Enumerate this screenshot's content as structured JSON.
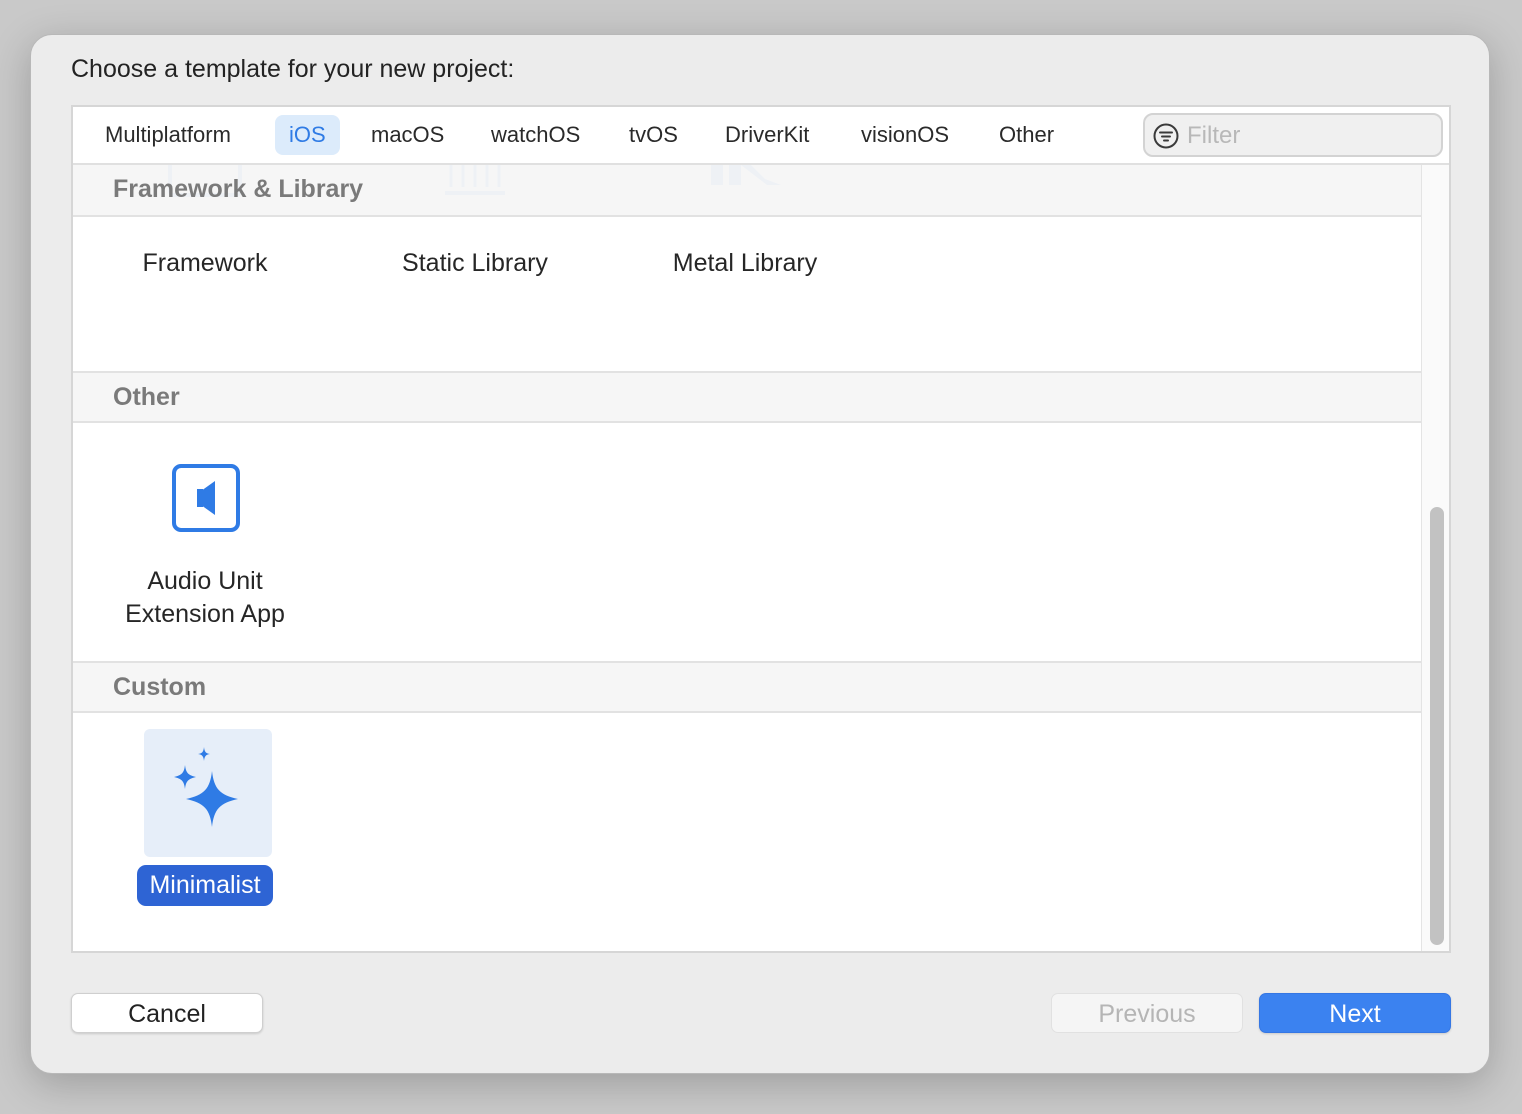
{
  "dialog": {
    "prompt": "Choose a template for your new project:"
  },
  "tabs": [
    {
      "label": "Multiplatform",
      "active": false
    },
    {
      "label": "iOS",
      "active": true
    },
    {
      "label": "macOS",
      "active": false
    },
    {
      "label": "watchOS",
      "active": false
    },
    {
      "label": "tvOS",
      "active": false
    },
    {
      "label": "DriverKit",
      "active": false
    },
    {
      "label": "visionOS",
      "active": false
    },
    {
      "label": "Other",
      "active": false
    }
  ],
  "filter": {
    "placeholder": "Filter",
    "value": "",
    "icon": "filter-circle-icon"
  },
  "sections": [
    {
      "title": "Framework & Library",
      "items": [
        {
          "label": "Framework",
          "icon": "framework-icon",
          "selected": false
        },
        {
          "label": "Static Library",
          "icon": "static-library-icon",
          "selected": false
        },
        {
          "label": "Metal Library",
          "icon": "metal-library-icon",
          "selected": false
        }
      ]
    },
    {
      "title": "Other",
      "items": [
        {
          "label": "Audio Unit\nExtension App",
          "label_line1": "Audio Unit",
          "label_line2": "Extension App",
          "icon": "audio-unit-icon",
          "selected": false
        }
      ]
    },
    {
      "title": "Custom",
      "items": [
        {
          "label": "Minimalist",
          "icon": "sparkles-icon",
          "selected": true
        }
      ]
    }
  ],
  "buttons": {
    "cancel": "Cancel",
    "previous": "Previous",
    "next": "Next"
  },
  "colors": {
    "accent": "#3b82f0",
    "selected_label_bg": "#2e64d4",
    "icon_blue": "#2f7be5",
    "section_header_text": "#7a7a7a"
  }
}
